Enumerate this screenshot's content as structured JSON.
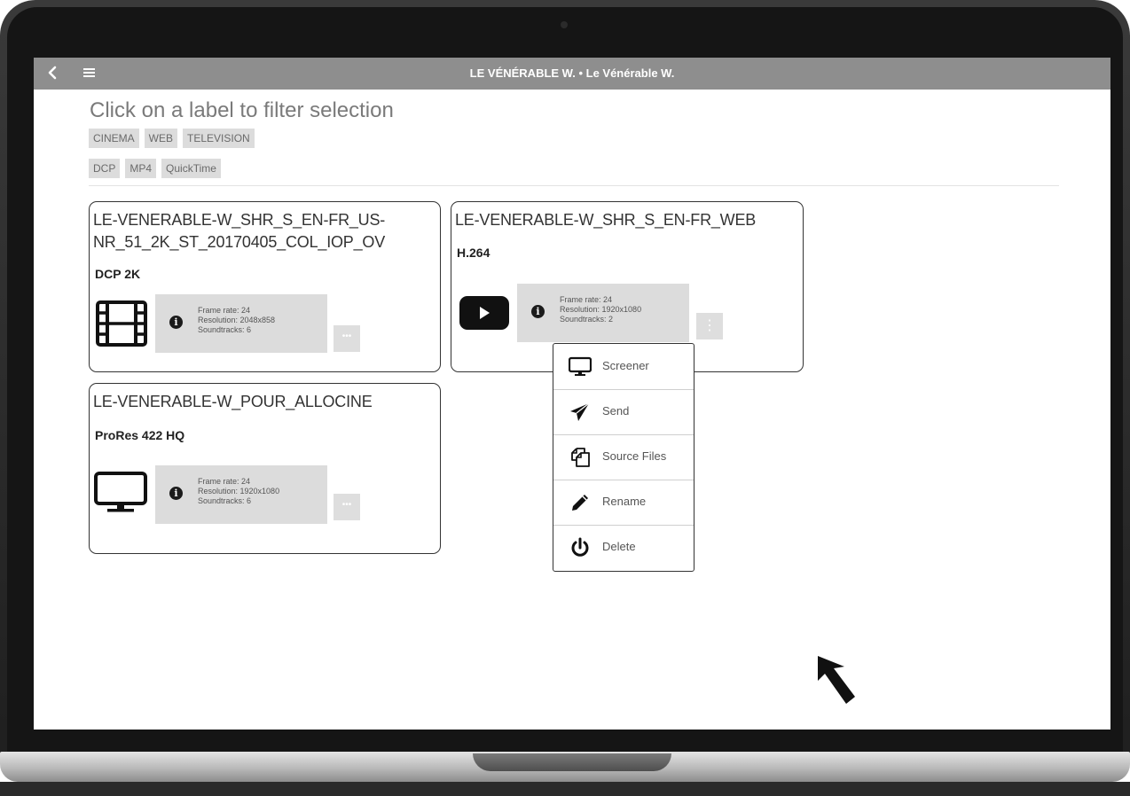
{
  "header": {
    "title": "LE VÉNÉRABLE W. • Le Vénérable W.",
    "back_icon": "chevron-left-icon",
    "menu_icon": "hamburger-menu-icon"
  },
  "filter": {
    "title": "Click on a label to filter selection",
    "distribution_tags": [
      "CINEMA",
      "WEB",
      "TELEVISION"
    ],
    "format_tags": [
      "DCP",
      "MP4",
      "QuickTime"
    ]
  },
  "cards": [
    {
      "title_line1": "LE-VENERABLE-W_SHR_S_EN-FR_US-",
      "title_line2": "NR_51_2K_ST_20170405_COL_IOP_OV",
      "format": "DCP 2K",
      "icon": "film-strip-icon",
      "frame_rate": "Frame rate: 24",
      "resolution": "Resolution: 2048x858",
      "soundtracks": "Soundtracks: 6",
      "more_label": "•••"
    },
    {
      "title_line1": "LE-VENERABLE-W_SHR_S_EN-FR_WEB",
      "format": "H.264",
      "icon": "play-video-icon",
      "frame_rate": "Frame rate: 24",
      "resolution": "Resolution: 1920x1080",
      "soundtracks": "Soundtracks: 2",
      "more_label": "⋮"
    },
    {
      "title_line1": "LE-VENERABLE-W_POUR_ALLOCINE",
      "format": "ProRes 422 HQ",
      "icon": "monitor-icon",
      "frame_rate": "Frame rate: 24",
      "resolution": "Resolution: 1920x1080",
      "soundtracks": "Soundtracks: 6",
      "more_label": "•••"
    }
  ],
  "context_menu": {
    "items": [
      {
        "label": "Screener",
        "icon": "monitor-icon"
      },
      {
        "label": "Send",
        "icon": "paper-plane-icon"
      },
      {
        "label": "Source Files",
        "icon": "copy-files-icon"
      },
      {
        "label": "Rename",
        "icon": "pencil-icon"
      },
      {
        "label": "Delete",
        "icon": "power-icon"
      }
    ]
  },
  "colors": {
    "topbar": "#8e8e8e",
    "tag_bg": "#dcdcdc",
    "info_bg": "#dcdcdc",
    "card_border": "#333333"
  }
}
